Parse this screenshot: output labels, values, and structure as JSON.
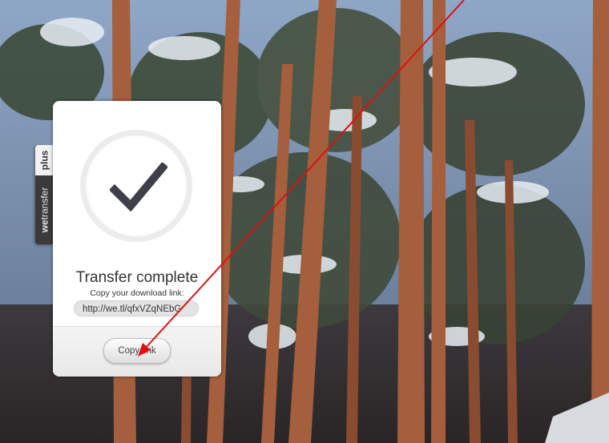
{
  "side_tab": {
    "plus_label": "plus",
    "brand_bold": "we",
    "brand_rest": "transfer"
  },
  "panel": {
    "title": "Transfer complete",
    "subtitle": "Copy your download link:",
    "link_value": "http://we.tl/qfxVZqNEbG",
    "copy_button_label": "Copy link"
  },
  "colors": {
    "annotation_arrow": "#e01010",
    "checkmark": "#3d4147"
  },
  "icons": {
    "success": "checkmark-icon"
  }
}
